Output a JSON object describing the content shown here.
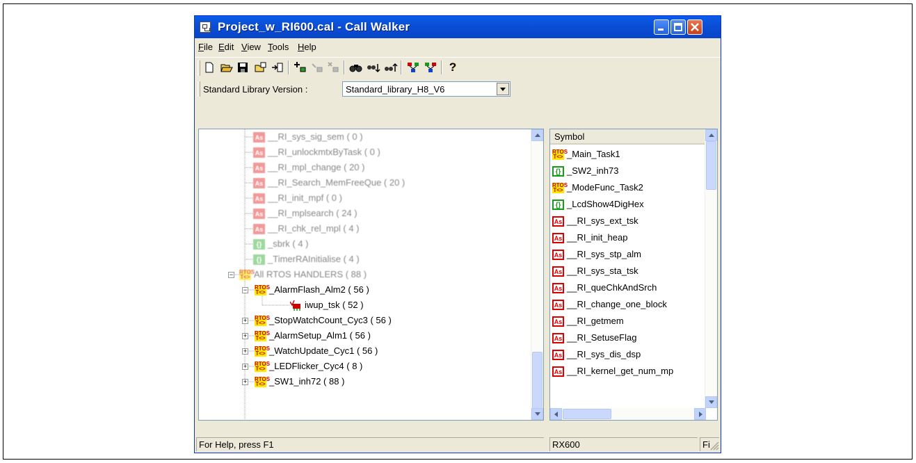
{
  "window": {
    "title": "Project_w_RI600.cal - Call Walker"
  },
  "menu": [
    {
      "label": "File",
      "u": "F",
      "rest": "ile"
    },
    {
      "label": "Edit",
      "u": "E",
      "rest": "dit"
    },
    {
      "label": "View",
      "u": "V",
      "rest": "iew"
    },
    {
      "label": "Tools",
      "u": "T",
      "rest": "ools"
    },
    {
      "label": "Help",
      "u": "H",
      "rest": "elp"
    }
  ],
  "library": {
    "label": "Standard Library Version :",
    "selected": "Standard_library_H8_V6"
  },
  "tree": {
    "rows": [
      {
        "icon": "as",
        "text": "__RI_sys_sig_sem ( 0 )"
      },
      {
        "icon": "as",
        "text": "__RI_unlockmtxByTask ( 0 )"
      },
      {
        "icon": "as",
        "text": "__RI_mpl_change ( 20 )"
      },
      {
        "icon": "as",
        "text": "__RI_Search_MemFreeQue ( 20 )"
      },
      {
        "icon": "as",
        "text": "__RI_init_mpf ( 0 )"
      },
      {
        "icon": "as",
        "text": "__RI_mplsearch ( 24 )"
      },
      {
        "icon": "as",
        "text": "__RI_chk_rel_mpl ( 4 )"
      },
      {
        "icon": "fn",
        "text": "_sbrk ( 4 )"
      },
      {
        "icon": "fn",
        "text": "_TimerRAInitialise ( 4 )"
      },
      {
        "icon": "rtos",
        "text": "All RTOS HANDLERS ( 88 )"
      },
      {
        "icon": "rtos",
        "text": "_AlarmFlash_Alm2 ( 56 )"
      },
      {
        "icon": "task",
        "text": "iwup_tsk ( 52 )"
      },
      {
        "icon": "rtos",
        "text": "_StopWatchCount_Cyc3 ( 56 )"
      },
      {
        "icon": "rtos",
        "text": "_AlarmSetup_Alm1 ( 56 )"
      },
      {
        "icon": "rtos",
        "text": "_WatchUpdate_Cyc1 ( 56 )"
      },
      {
        "icon": "rtos",
        "text": "_LEDFlicker_Cyc4 ( 8 )"
      },
      {
        "icon": "rtos",
        "text": "_SW1_inh72 ( 88 )"
      }
    ]
  },
  "symbols": {
    "header": "Symbol",
    "rows": [
      {
        "icon": "rtos",
        "text": "_Main_Task1"
      },
      {
        "icon": "fn",
        "text": "_SW2_inh73"
      },
      {
        "icon": "rtos",
        "text": "_ModeFunc_Task2"
      },
      {
        "icon": "fn",
        "text": "_LcdShow4DigHex"
      },
      {
        "icon": "as",
        "text": "__RI_sys_ext_tsk"
      },
      {
        "icon": "as",
        "text": "__RI_init_heap"
      },
      {
        "icon": "as",
        "text": "__RI_sys_stp_alm"
      },
      {
        "icon": "as",
        "text": "__RI_sys_sta_tsk"
      },
      {
        "icon": "as",
        "text": "__RI_queChkAndSrch"
      },
      {
        "icon": "as",
        "text": "__RI_change_one_block"
      },
      {
        "icon": "as",
        "text": "__RI_getmem"
      },
      {
        "icon": "as",
        "text": "__RI_SetuseFlag"
      },
      {
        "icon": "as",
        "text": "__RI_sys_dis_dsp"
      },
      {
        "icon": "as",
        "text": "__RI_kernel_get_num_mp"
      }
    ]
  },
  "icons": {
    "as": "As",
    "fn": "{}",
    "rtos_top": "RTOS",
    "rtos_bottom": "T<>"
  },
  "status": {
    "help": "For Help, press F1",
    "target": "RX600",
    "extra": "Fi"
  }
}
